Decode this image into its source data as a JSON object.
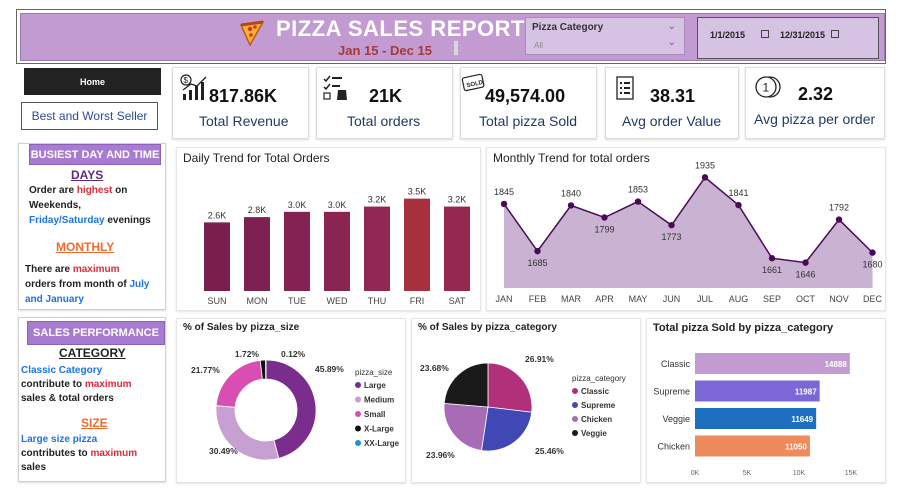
{
  "header": {
    "title": "PIZZA SALES REPORT",
    "subtitle": "Jan 15 - Dec 15",
    "category_slicer": {
      "label": "Pizza Category",
      "value": "All"
    },
    "date_range": {
      "start": "1/1/2015",
      "end": "12/31/2015"
    }
  },
  "nav": {
    "home": "Home",
    "best_worst": "Best and Worst Seller"
  },
  "kpis": [
    {
      "value": "817.86K",
      "label": "Total Revenue",
      "icon": "revenue-chart-icon"
    },
    {
      "value": "21K",
      "label": "Total orders",
      "icon": "order-checklist-icon"
    },
    {
      "value": "49,574.00",
      "label": "Total pizza Sold",
      "icon": "sold-tag-icon"
    },
    {
      "value": "38.31",
      "label": "Avg order Value",
      "icon": "receipt-icon"
    },
    {
      "value": "2.32",
      "label": "Avg pizza per order",
      "icon": "coins-icon"
    }
  ],
  "busiest": {
    "heading": "BUSIEST DAY AND TIME",
    "days_title": "DAYS",
    "days_l1a": "Order are ",
    "days_l1b": "highest",
    "days_l1c": " on",
    "days_l2": "Weekends,",
    "days_l3a": "Friday/Saturday",
    "days_l3b": "  evenings",
    "monthly_title": "MONTHLY",
    "m_l1a": "There are ",
    "m_l1b": "maximum",
    "m_l2a": "orders from month of ",
    "m_l2b": "July",
    "m_l3a": "and January"
  },
  "performance": {
    "heading": "SALES PERFORMANCE",
    "cat_title": "CATEGORY",
    "c_l1": "Classic Category",
    "c_l2a": "contribute to ",
    "c_l2b": "maximum",
    "c_l3": "sales & total orders",
    "size_title": "SIZE",
    "s_l1": "Large size pizza",
    "s_l2a": "contributes to ",
    "s_l2b": "maximum",
    "s_l3": "sales"
  },
  "colors": {
    "header_band": "#c39bd3",
    "accent_purple": "#a77bd1",
    "line_purple": "#4b0a55",
    "area_fill": "#c4aacd",
    "highlight_red": "#e02b3c",
    "highlight_blue": "#1a73e8"
  },
  "chart_data": [
    {
      "type": "bar",
      "title": "Daily Trend for Total Orders",
      "categories": [
        "SUN",
        "MON",
        "TUE",
        "WED",
        "THU",
        "FRI",
        "SAT"
      ],
      "values": [
        2.6,
        2.8,
        3.0,
        3.0,
        3.2,
        3.5,
        3.2
      ],
      "labels": [
        "2.6K",
        "2.8K",
        "3.0K",
        "3.0K",
        "3.2K",
        "3.5K",
        "3.2K"
      ],
      "colors": [
        "#7a1f4e",
        "#7f2150",
        "#842352",
        "#8a2552",
        "#902853",
        "#a8303f",
        "#94284f"
      ],
      "ylim": [
        0,
        3.6
      ]
    },
    {
      "type": "area",
      "title": "Monthly Trend for total orders",
      "categories": [
        "JAN",
        "FEB",
        "MAR",
        "APR",
        "MAY",
        "JUN",
        "JUL",
        "AUG",
        "SEP",
        "OCT",
        "NOV",
        "DEC"
      ],
      "values": [
        1845,
        1685,
        1840,
        1799,
        1853,
        1773,
        1935,
        1841,
        1661,
        1646,
        1792,
        1680
      ],
      "ylim": [
        1560,
        1960
      ]
    },
    {
      "type": "pie",
      "donut": true,
      "title": "% of Sales by pizza_size",
      "legend_title": "pizza_size",
      "legend_position": "right",
      "slices": [
        {
          "name": "Large",
          "value": 45.89,
          "label": "45.89%",
          "color": "#7b2d8e"
        },
        {
          "name": "Medium",
          "value": 30.49,
          "label": "30.49%",
          "color": "#c7a0d1"
        },
        {
          "name": "Small",
          "value": 21.77,
          "label": "21.77%",
          "color": "#d94fb1"
        },
        {
          "name": "X-Large",
          "value": 1.72,
          "label": "1.72%",
          "color": "#111111"
        },
        {
          "name": "XX-Large",
          "value": 0.12,
          "label": "0.12%",
          "color": "#1a8fe8"
        }
      ]
    },
    {
      "type": "pie",
      "title": "% of Sales by pizza_category",
      "legend_title": "pizza_category",
      "legend_position": "right",
      "slices": [
        {
          "name": "Classic",
          "value": 26.91,
          "label": "26.91%",
          "color": "#b0307a"
        },
        {
          "name": "Supreme",
          "value": 25.46,
          "label": "25.46%",
          "color": "#3f48b5"
        },
        {
          "name": "Chicken",
          "value": 23.96,
          "label": "23.96%",
          "color": "#a86bb5"
        },
        {
          "name": "Veggie",
          "value": 23.68,
          "label": "23.68%",
          "color": "#1a1a1a"
        }
      ]
    },
    {
      "type": "bar",
      "orientation": "horizontal",
      "title": "Total pizza Sold by pizza_category",
      "categories": [
        "Classic",
        "Supreme",
        "Veggie",
        "Chicken"
      ],
      "values": [
        14888,
        11987,
        11649,
        11050
      ],
      "colors": [
        "#c39bd3",
        "#7b68d6",
        "#1f6fc0",
        "#ef8a5a"
      ],
      "xlim": [
        0,
        15000
      ],
      "xticks": [
        "0K",
        "5K",
        "10K",
        "15K"
      ]
    }
  ]
}
